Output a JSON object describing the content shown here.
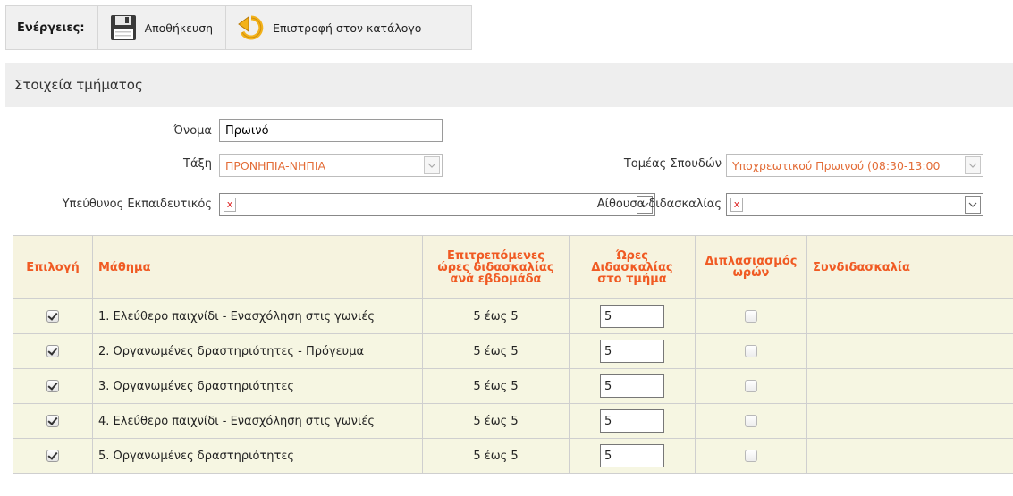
{
  "toolbar": {
    "label": "Ενέργειες:",
    "save_label": "Αποθήκευση",
    "back_label": "Επιστροφή στον κατάλογο"
  },
  "section": {
    "title": "Στοιχεία τμήματος"
  },
  "form": {
    "name_label": "Όνομα",
    "name_value": "Πρωινό",
    "class_label": "Τάξη",
    "class_value": "ΠΡΟΝΗΠΙΑ-ΝΗΠΙΑ",
    "sector_label": "Τομέας Σπουδών",
    "sector_value": "Υποχρεωτικού Πρωινού (08:30-13:00",
    "teacher_label": "Υπεύθυνος Εκπαιδευτικός",
    "teacher_value": "x",
    "room_label": "Αίθουσα διδασκαλίας",
    "room_value": "x"
  },
  "table": {
    "headers": {
      "select": "Επιλογή",
      "course": "Μάθημα",
      "allowed_line1": "Επιτρεπόμενες",
      "allowed_line2": "ώρες διδασκαλίας",
      "allowed_line3": "ανά εβδομάδα",
      "hours_line1": "Ώρες Διδασκαλίας",
      "hours_line2": "στο τμήμα",
      "double_line1": "Διπλασιασμός",
      "double_line2": "ωρών",
      "coteach": "Συνδιδασκαλία"
    },
    "rows": [
      {
        "selected": true,
        "course": "1. Ελεύθερο παιχνίδι - Ενασχόληση στις γωνιές",
        "allowed": "5 έως 5",
        "hours": "5",
        "doubled": false,
        "coteach": ""
      },
      {
        "selected": true,
        "course": "2. Οργανωμένες δραστηριότητες - Πρόγευμα",
        "allowed": "5 έως 5",
        "hours": "5",
        "doubled": false,
        "coteach": ""
      },
      {
        "selected": true,
        "course": "3. Οργανωμένες δραστηριότητες",
        "allowed": "5 έως 5",
        "hours": "5",
        "doubled": false,
        "coteach": ""
      },
      {
        "selected": true,
        "course": "4. Ελεύθερο παιχνίδι - Ενασχόληση στις γωνιές",
        "allowed": "5 έως 5",
        "hours": "5",
        "doubled": false,
        "coteach": ""
      },
      {
        "selected": true,
        "course": "5. Οργανωμένες δραστηριότητες",
        "allowed": "5 έως 5",
        "hours": "5",
        "doubled": false,
        "coteach": ""
      }
    ]
  },
  "icons": {
    "save": "floppy-disk-icon",
    "back": "return-arrow-icon"
  },
  "colors": {
    "accent": "#f05a23",
    "select_text": "#e36c37",
    "row_bg": "#f6f6e2"
  }
}
